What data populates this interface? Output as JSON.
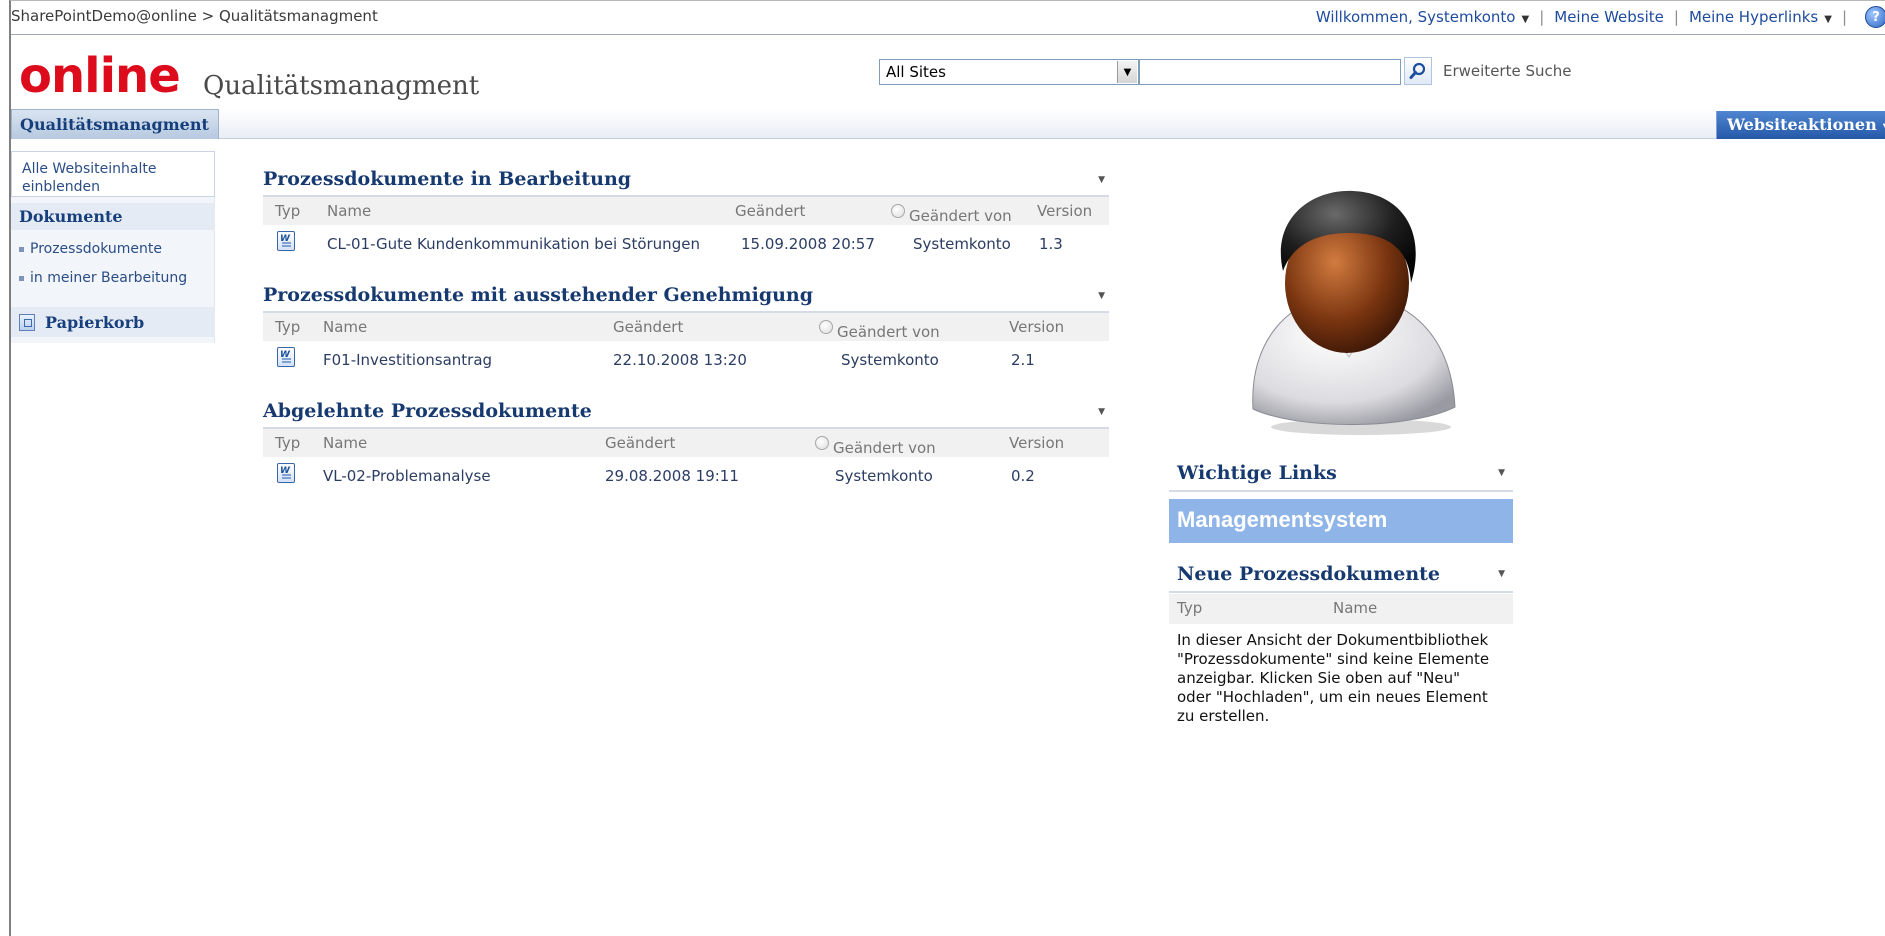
{
  "topbar": {
    "breadcrumb": "SharePointDemo@online > Qualitätsmanagment",
    "welcome": "Willkommen, Systemkonto",
    "my_site": "Meine Website",
    "my_links": "Meine Hyperlinks",
    "help_icon": "help-icon"
  },
  "header": {
    "logo": "online",
    "site_title": "Qualitätsmanagment",
    "search_scope": "All Sites",
    "search_value": "",
    "advanced_search": "Erweiterte Suche"
  },
  "tabs": {
    "home": "Qualitätsmanagment",
    "site_actions": "Websiteaktionen"
  },
  "leftnav": {
    "all_content": "Alle Websiteinhalte einblenden",
    "documents_heading": "Dokumente",
    "items": [
      "Prozessdokumente",
      "in meiner Bearbeitung"
    ],
    "recycle_bin": "Papierkorb"
  },
  "webparts": [
    {
      "title": "Prozessdokumente in Bearbeitung",
      "headers": {
        "type": "Typ",
        "name": "Name",
        "modified": "Geändert",
        "modified_by": "Geändert von",
        "version": "Version"
      },
      "row": {
        "name": "CL-01-Gute Kundenkommunikation bei Störungen",
        "modified": "15.09.2008 20:57",
        "modified_by": "Systemkonto",
        "version": "1.3"
      }
    },
    {
      "title": "Prozessdokumente mit ausstehender Genehmigung",
      "headers": {
        "type": "Typ",
        "name": "Name",
        "modified": "Geändert",
        "modified_by": "Geändert von",
        "version": "Version"
      },
      "row": {
        "name": "F01-Investitionsantrag",
        "modified": "22.10.2008 13:20",
        "modified_by": "Systemkonto",
        "version": "2.1"
      }
    },
    {
      "title": "Abgelehnte Prozessdokumente",
      "headers": {
        "type": "Typ",
        "name": "Name",
        "modified": "Geändert",
        "modified_by": "Geändert von",
        "version": "Version"
      },
      "row": {
        "name": "VL-02-Problemanalyse",
        "modified": "29.08.2008 19:11",
        "modified_by": "Systemkonto",
        "version": "0.2"
      }
    }
  ],
  "right": {
    "links_title": "Wichtige Links",
    "banner": "Managementsystem",
    "new_docs_title": "Neue Prozessdokumente",
    "new_docs_headers": {
      "type": "Typ",
      "name": "Name"
    },
    "empty_message": "In dieser Ansicht der Dokumentbibliothek \"Prozessdokumente\" sind keine Elemente anzeigbar. Klicken Sie oben auf \"Neu\" oder \"Hochladen\", um ein neues Element zu erstellen."
  },
  "colors": {
    "logo_red": "#dd0c1c",
    "heading_blue": "#16396f",
    "banner_blue": "#8fb5e8",
    "site_actions_blue": "#2559a8"
  }
}
